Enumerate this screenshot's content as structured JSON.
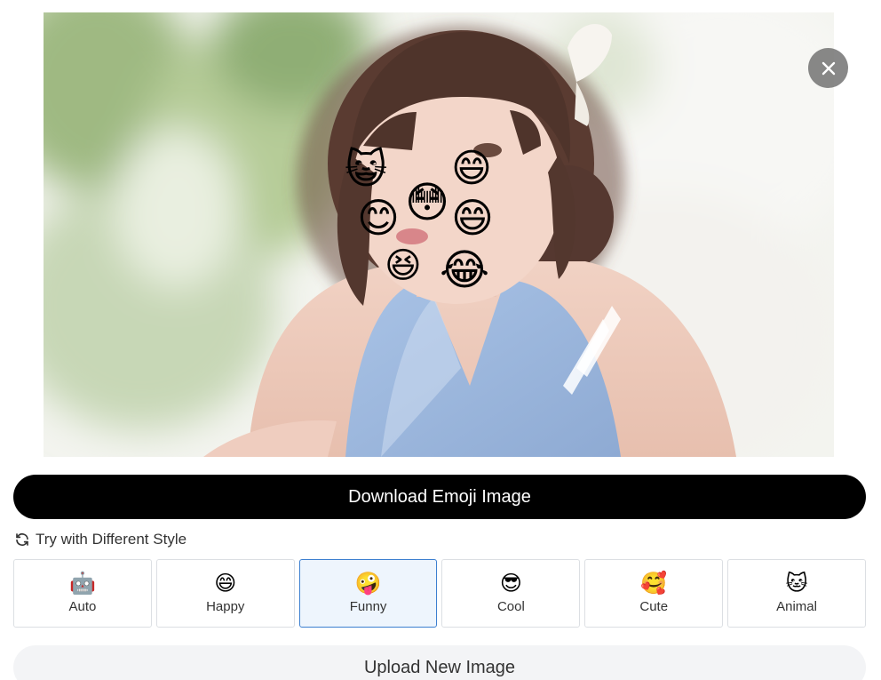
{
  "photo": {
    "stickers": [
      "😺",
      "😄",
      "😊",
      "😳",
      "😄",
      "😆",
      "😂"
    ]
  },
  "close_button": {
    "icon": "close-icon"
  },
  "download_button": {
    "label": "Download Emoji Image"
  },
  "style_section": {
    "heading": "Try with Different Style",
    "icon": "refresh-icon",
    "options": [
      {
        "label": "Auto",
        "emoji": "🤖",
        "selected": false
      },
      {
        "label": "Happy",
        "emoji": "😄",
        "selected": false
      },
      {
        "label": "Funny",
        "emoji": "🤪",
        "selected": true
      },
      {
        "label": "Cool",
        "emoji": "😎",
        "selected": false
      },
      {
        "label": "Cute",
        "emoji": "🥰",
        "selected": false
      },
      {
        "label": "Animal",
        "emoji": "🐱",
        "selected": false
      }
    ]
  },
  "upload_button": {
    "label": "Upload New Image"
  },
  "colors": {
    "selected_border": "#3c7fd0",
    "selected_bg": "#eef5fd",
    "download_bg": "#000000",
    "upload_bg": "#f3f4f6"
  }
}
